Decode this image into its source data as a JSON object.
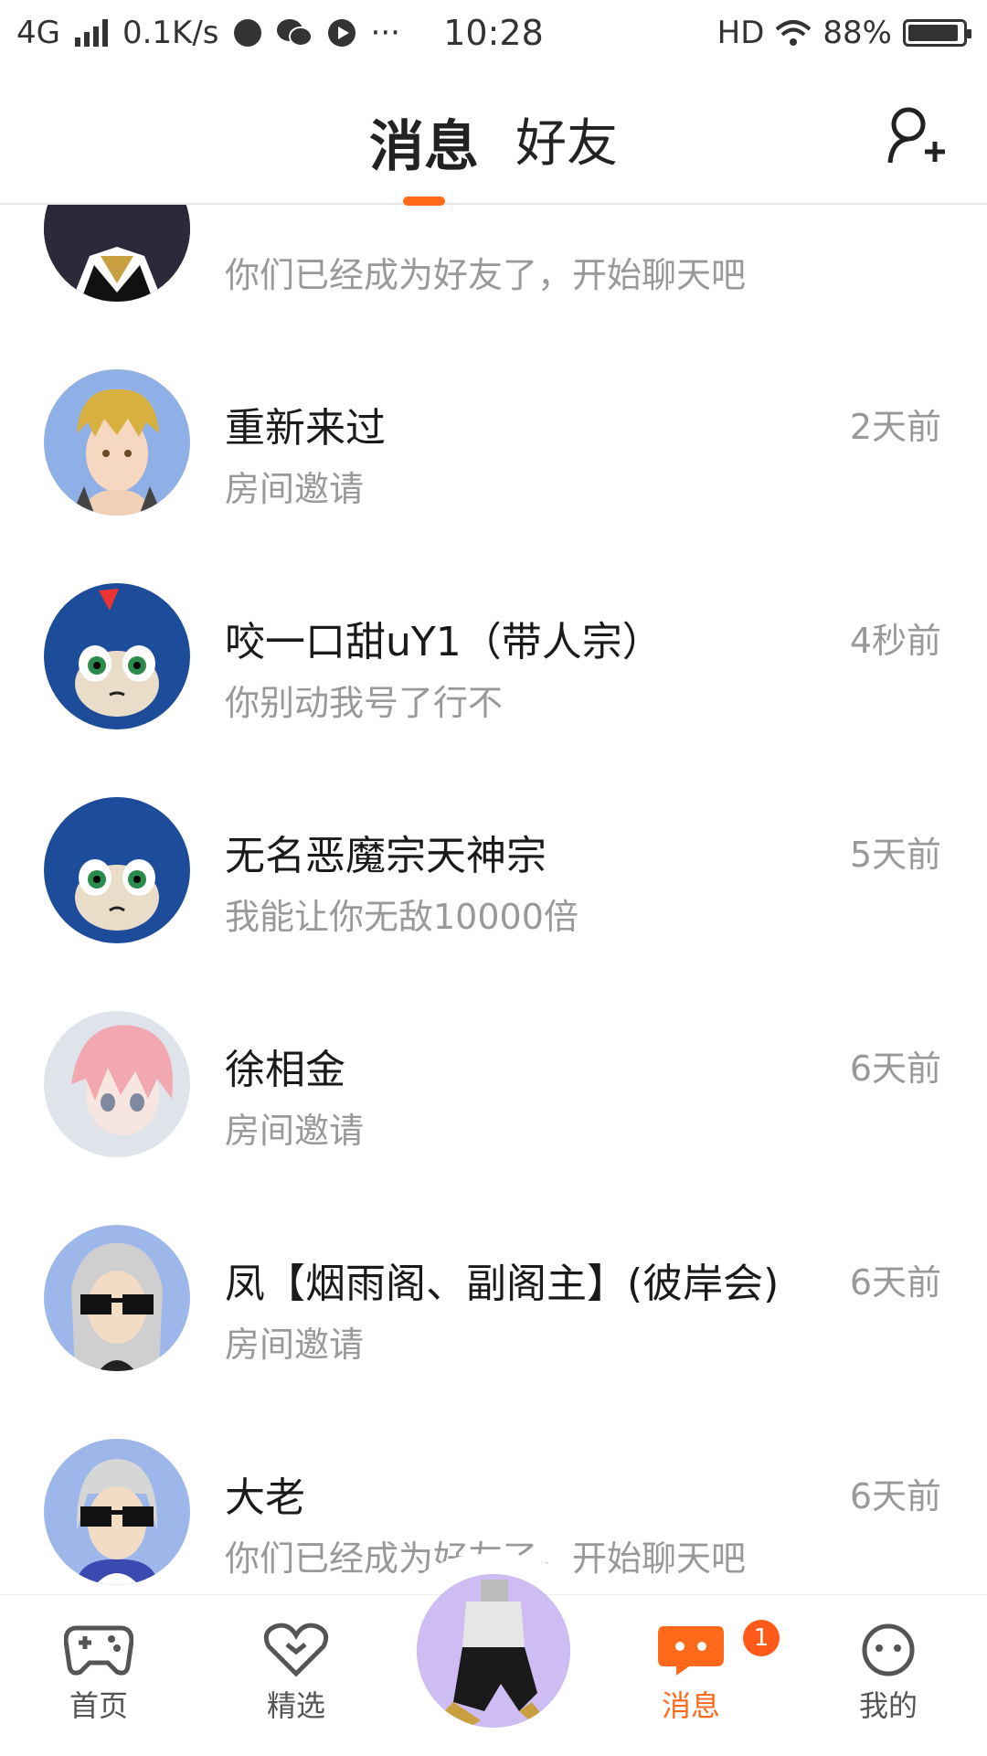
{
  "status_bar": {
    "network": "4G",
    "speed": "0.1K/s",
    "more": "···",
    "time": "10:28",
    "hd": "HD",
    "battery": "88%"
  },
  "header": {
    "tabs": [
      {
        "label": "消息",
        "active": true
      },
      {
        "label": "好友",
        "active": false
      }
    ],
    "accent": "#ff6a1a"
  },
  "conversations": [
    {
      "name": "",
      "preview": "你们已经成为好友了，开始聊天吧",
      "time": "",
      "avatar": "anime-dark-hair"
    },
    {
      "name": "重新来过",
      "preview": "房间邀请",
      "time": "2天前",
      "avatar": "anime-blond"
    },
    {
      "name": "咬一口甜uY1（带人宗）",
      "preview": "你别动我号了行不",
      "time": "4秒前",
      "avatar": "blue-hedgehog"
    },
    {
      "name": "无名恶魔宗天神宗",
      "preview": "我能让你无敌10000倍",
      "time": "5天前",
      "avatar": "blue-hedgehog"
    },
    {
      "name": "徐相金",
      "preview": "房间邀请",
      "time": "6天前",
      "avatar": "anime-pink-hair"
    },
    {
      "name": "凤【烟雨阁、副阁主】(彼岸会)",
      "preview": "房间邀请",
      "time": "6天前",
      "avatar": "anime-sunglasses-long-hair"
    },
    {
      "name": "大老",
      "preview": "你们已经成为好友了，开始聊天吧",
      "time": "6天前",
      "avatar": "anime-sunglasses-silver"
    }
  ],
  "bottom_nav": {
    "items": [
      {
        "label": "首页",
        "icon": "gamepad-icon"
      },
      {
        "label": "精选",
        "icon": "heart-icon"
      },
      {
        "label": "消息",
        "icon": "chat-bubble-icon",
        "badge": "1",
        "active": true
      },
      {
        "label": "我的",
        "icon": "face-icon"
      }
    ]
  }
}
